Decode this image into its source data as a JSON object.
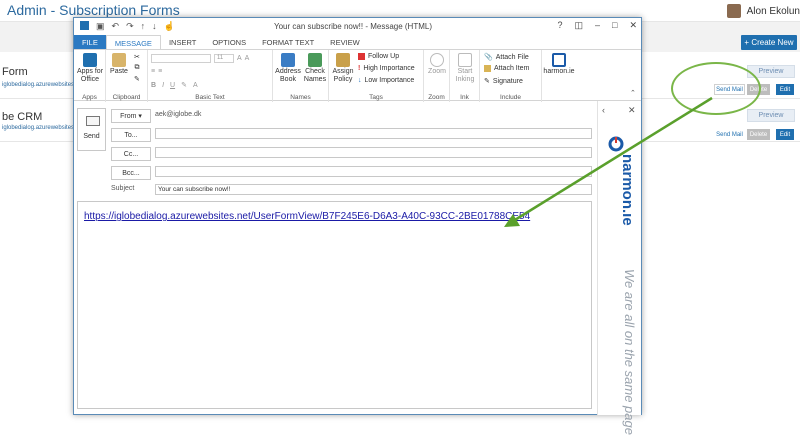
{
  "background": {
    "title": "Admin - Subscription Forms",
    "user": "Alon Ekolun",
    "create_button": "+ Create New",
    "rows": [
      {
        "name": "Form",
        "url": "iglobedialog.azurewebsites.net/",
        "preview": "Preview",
        "send_mail": "Send Mail",
        "delete": "Delete",
        "edit": "Edit"
      },
      {
        "name": "be CRM",
        "url": "iglobedialog.azurewebsites.net/",
        "preview": "Preview",
        "send_mail": "Send Mail",
        "delete": "Delete",
        "edit": "Edit"
      }
    ],
    "highlight_color": "#7ab648"
  },
  "window": {
    "title": "Your can subscribe now!! - Message (HTML)",
    "tabs": [
      "FILE",
      "MESSAGE",
      "INSERT",
      "OPTIONS",
      "FORMAT TEXT",
      "REVIEW"
    ],
    "active_tab": "MESSAGE",
    "ribbon": {
      "apps": {
        "button": "Apps for Office",
        "label": "Apps"
      },
      "clipboard": {
        "button": "Paste",
        "label": "Clipboard"
      },
      "basic_text": {
        "font_size": "11",
        "label": "Basic Text"
      },
      "names": {
        "address_book": "Address Book",
        "check_names": "Check Names",
        "label": "Names"
      },
      "tags": {
        "assign_policy": "Assign Policy",
        "follow_up": "Follow Up",
        "high_importance": "High Importance",
        "low_importance": "Low Importance",
        "label": "Tags"
      },
      "zoom": {
        "button": "Zoom",
        "label": "Zoom"
      },
      "ink": {
        "button": "Start Inking",
        "label": "Ink"
      },
      "include": {
        "attach_file": "Attach File",
        "attach_item": "Attach Item",
        "signature": "Signature",
        "label": "Include"
      },
      "harmon": {
        "button": "harmon.ie"
      }
    },
    "compose": {
      "send": "Send",
      "from_label": "From",
      "from_value": "aek@iglobe.dk",
      "to_label": "To...",
      "cc_label": "Cc...",
      "bcc_label": "Bcc...",
      "subject_label": "Subject",
      "subject_value": "Your can subscribe now!!",
      "body_link": "https://iglobedialog.azurewebsites.net/UserFormView/B7F245E6-D6A3-A40C-93CC-2BE01788CE54"
    },
    "side_panel": {
      "brand": "harmon.ie",
      "tagline": "We are all on the same page",
      "brand_color": "#1b5aa8",
      "accent_color": "#d83b2e"
    }
  }
}
